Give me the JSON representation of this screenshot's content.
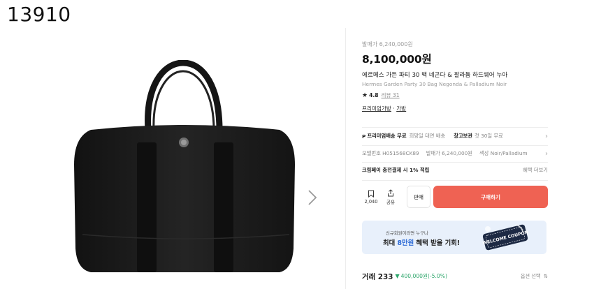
{
  "watermark": "13910",
  "product": {
    "orig_price": "발매가 6,240,000원",
    "price": "8,100,000원",
    "name_ko": "에르메스 가든 파티 30 백 네곤다 & 팔라듐 하드웨어 누아",
    "name_en": "Hermes Garden Party 30 Bag Negonda & Palladium Noir",
    "rating_score": "4.8",
    "rating_reviews": "리뷰 31",
    "breadcrumb": {
      "category": "프리미엄가방",
      "sep": "·",
      "sub": "가방"
    }
  },
  "shipping": {
    "label": "프리미엄배송 무료",
    "desc": "희망일 대면 배송",
    "storage_label": "창고보관",
    "storage_desc": "첫 30일 무료"
  },
  "specs": {
    "model": "모델번호 H051568CK89",
    "release": "발매가 6,240,000원",
    "color": "색상 Noir/Palladium"
  },
  "payment": {
    "promo": "크림페이 충전결제 시 1% 적립",
    "more": "혜택 더보기"
  },
  "actions": {
    "wish_count": "2,040",
    "share_label": "공유",
    "sell_label": "판매",
    "buy_label": "구매하기"
  },
  "banner": {
    "small": "신규회원이라면 누구나",
    "big_prefix": "최대 ",
    "big_highlight": "8만원",
    "big_suffix": " 혜택 받을 기회!",
    "coupon_text": "WELCOME COUPON"
  },
  "trades": {
    "label": "거래 233",
    "price": "400,000원(-5.0%)",
    "sort": "옵션 선택"
  },
  "colors": {
    "buy": "#ef6253",
    "banner": "#e8f0fb",
    "down": "#2da66b",
    "bag": "#1c1c1c"
  },
  "icons": [
    "star-icon",
    "bookmark-icon",
    "share-icon",
    "chevron-right-icon",
    "sort-icon",
    "shipping-icon"
  ]
}
